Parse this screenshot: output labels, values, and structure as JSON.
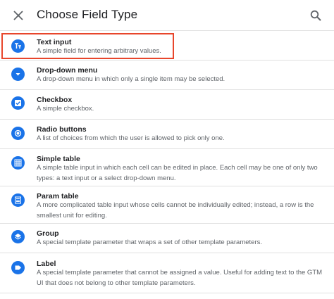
{
  "header": {
    "title": "Choose Field Type",
    "close_icon": "close-icon",
    "search_icon": "search-icon"
  },
  "colors": {
    "accent": "#1a73e8",
    "highlight": "#e8462c"
  },
  "items": [
    {
      "name": "Text input",
      "desc": "A simple field for entering arbitrary values.",
      "icon": "text-icon"
    },
    {
      "name": "Drop-down menu",
      "desc": "A drop-down menu in which only a single item may be selected.",
      "icon": "dropdown-icon"
    },
    {
      "name": "Checkbox",
      "desc": "A simple checkbox.",
      "icon": "checkbox-icon"
    },
    {
      "name": "Radio buttons",
      "desc": "A list of choices from which the user is allowed to pick only one.",
      "icon": "radio-icon"
    },
    {
      "name": "Simple table",
      "desc": "A simple table input in which each cell can be edited in place. Each cell may be one of only two types: a text input or a select drop-down menu.",
      "icon": "grid-icon"
    },
    {
      "name": "Param table",
      "desc": "A more complicated table input whose cells cannot be individually edited; instead, a row is the smallest unit for editing.",
      "icon": "list-icon"
    },
    {
      "name": "Group",
      "desc": "A special template parameter that wraps a set of other template parameters.",
      "icon": "layers-icon"
    },
    {
      "name": "Label",
      "desc": "A special template parameter that cannot be assigned a value. Useful for adding text to the GTM UI that does not belong to other template parameters.",
      "icon": "label-icon"
    }
  ]
}
